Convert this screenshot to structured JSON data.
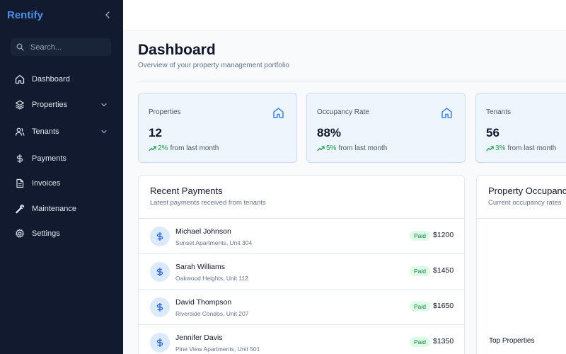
{
  "sidebar": {
    "brand": "Rentify",
    "search_placeholder": "Search...",
    "items": [
      {
        "label": "Dashboard",
        "icon": "home-icon"
      },
      {
        "label": "Properties",
        "icon": "layers-icon",
        "expandable": true
      },
      {
        "label": "Tenants",
        "icon": "users-icon",
        "expandable": true
      },
      {
        "label": "Payments",
        "icon": "dollar-icon"
      },
      {
        "label": "Invoices",
        "icon": "file-icon"
      },
      {
        "label": "Maintenance",
        "icon": "wrench-icon"
      },
      {
        "label": "Settings",
        "icon": "gear-icon"
      }
    ]
  },
  "header": {
    "title": "Dashboard",
    "subtitle": "Overview of your property management portfolio"
  },
  "stats": [
    {
      "label": "Properties",
      "value": "12",
      "change": "2%",
      "suffix": "from last month",
      "icon": "home-icon"
    },
    {
      "label": "Occupancy Rate",
      "value": "88%",
      "change": "5%",
      "suffix": "from last month",
      "icon": "home-icon"
    },
    {
      "label": "Tenants",
      "value": "56",
      "change": "3%",
      "suffix": "from last month"
    }
  ],
  "payments": {
    "title": "Recent Payments",
    "subtitle": "Latest payments received from tenants",
    "rows": [
      {
        "name": "Michael Johnson",
        "unit": "Sunset Apartments, Unit 304",
        "status": "Paid",
        "amount": "$1200"
      },
      {
        "name": "Sarah Williams",
        "unit": "Oakwood Heights, Unit 112",
        "status": "Paid",
        "amount": "$1450"
      },
      {
        "name": "David Thompson",
        "unit": "Riverside Condos, Unit 207",
        "status": "Paid",
        "amount": "$1650"
      },
      {
        "name": "Jennifer Davis",
        "unit": "Pine View Apartments, Unit 501",
        "status": "Paid",
        "amount": "$1350"
      }
    ]
  },
  "occupancy": {
    "title": "Property Occupancy",
    "subtitle": "Current occupancy rates",
    "top_properties_label": "Top Properties"
  },
  "colors": {
    "sidebar_bg": "#111a2e",
    "brand": "#4b8fe8",
    "accent": "#3b82f6",
    "positive": "#16a34a",
    "paid_badge_bg": "#dcfce7"
  }
}
